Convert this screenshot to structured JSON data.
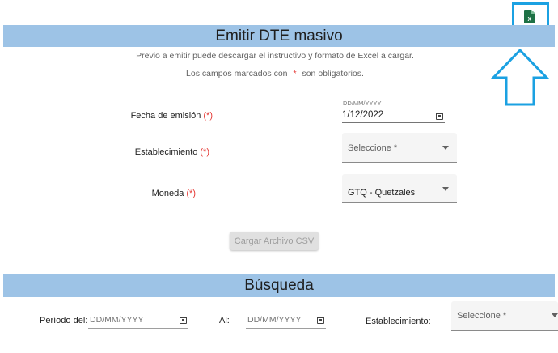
{
  "header": {
    "title": "Emitir DTE masivo",
    "info_line1": "Previo a emitir puede descargar el instructivo y formato de Excel a cargar.",
    "info_line2_before": "Los campos marcados con",
    "info_line2_marker": "*",
    "info_line2_after": "son obligatorios."
  },
  "form": {
    "required_mark": "(*)",
    "fecha": {
      "label": "Fecha de emisión",
      "format_hint": "DD/MM/YYYY",
      "value": "1/12/2022"
    },
    "establecimiento": {
      "label": "Establecimiento",
      "value": "Seleccione *"
    },
    "moneda": {
      "label": "Moneda",
      "value": "GTQ - Quetzales"
    },
    "upload_button": "Cargar Archivo CSV"
  },
  "search": {
    "title": "Búsqueda",
    "periodo_label": "Período del:",
    "periodo_placeholder": "DD/MM/YYYY",
    "al_label": "Al:",
    "al_placeholder": "DD/MM/YYYY",
    "establecimiento_label": "Establecimiento:",
    "establecimiento_value": "Seleccione *"
  },
  "icons": {
    "excel": "excel-file-icon",
    "calendar": "calendar-icon",
    "dropdown": "chevron-down-icon",
    "annotation_arrow": "up-arrow-icon"
  },
  "colors": {
    "section_bar": "#9dc3e6",
    "required": "#e53935",
    "highlight": "#1ba1e2",
    "excel_green": "#1e7145"
  }
}
